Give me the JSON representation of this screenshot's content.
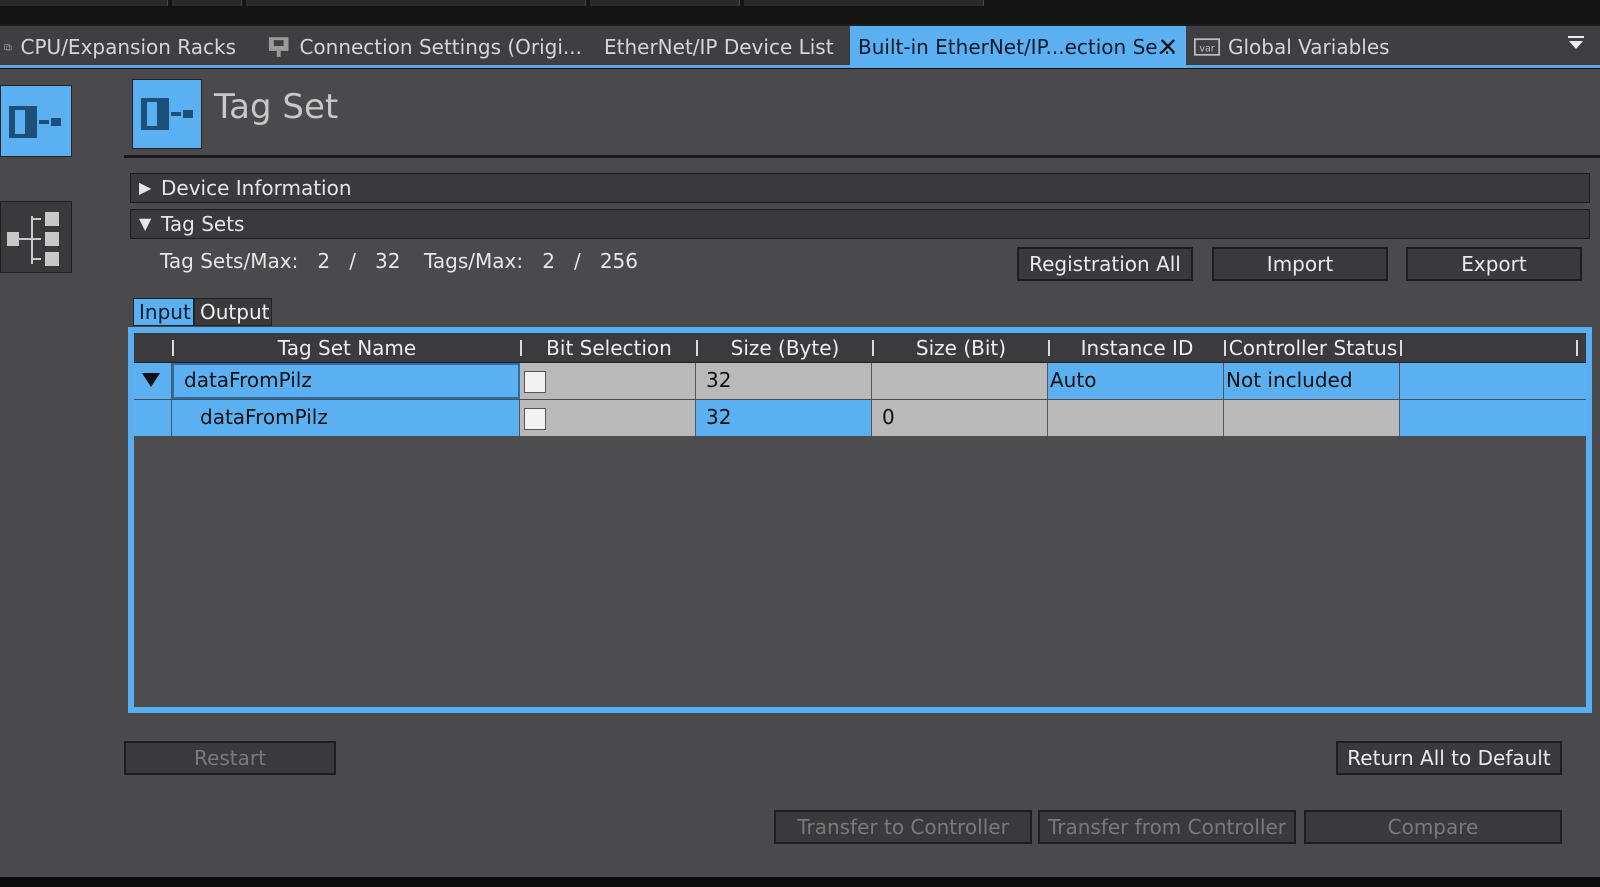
{
  "tabs": [
    {
      "label": "CPU/Expansion Racks",
      "icon": "rack-icon",
      "active": false
    },
    {
      "label": "Connection Settings (Origi...",
      "icon": "connection-icon",
      "active": false
    },
    {
      "label": "EtherNet/IP Device List",
      "icon": "",
      "active": false
    },
    {
      "label": "Built-in EtherNet/IP...ection Se...",
      "icon": "",
      "active": true,
      "close": "✕"
    },
    {
      "label": "Global Variables",
      "icon": "var-icon",
      "active": false
    }
  ],
  "page": {
    "title": "Tag Set"
  },
  "sections": {
    "device_information": {
      "label": "Device Information",
      "expanded": false,
      "toggle": "▶"
    },
    "tag_sets": {
      "label": "Tag Sets",
      "expanded": true,
      "toggle": "▼"
    }
  },
  "stats": {
    "tag_sets_label": "Tag Sets/Max:",
    "tag_sets_value": "2",
    "tag_sets_max": "32",
    "tags_label": "Tags/Max:",
    "tags_value": "2",
    "tags_max": "256",
    "slash": "/"
  },
  "buttons": {
    "registration_all": "Registration All",
    "import": "Import",
    "export": "Export",
    "restart": "Restart",
    "return_all_default": "Return All to Default",
    "transfer_to": "Transfer to Controller",
    "transfer_from": "Transfer from Controller",
    "compare": "Compare"
  },
  "subtabs": {
    "input": "Input",
    "output": "Output",
    "active": "input"
  },
  "table": {
    "columns": [
      "Tag Set Name",
      "Bit Selection",
      "Size (Byte)",
      "Size (Bit)",
      "Instance ID",
      "Controller Status"
    ],
    "rows": [
      {
        "name": "dataFromPilz",
        "bit_selection": false,
        "size_byte": "32",
        "size_bit": "",
        "instance_id": "Auto",
        "controller_status": "Not included",
        "expanded": true
      },
      {
        "name": "dataFromPilz",
        "bit_selection": false,
        "size_byte": "32",
        "size_bit": "0",
        "instance_id": "",
        "controller_status": "",
        "child": true
      }
    ]
  },
  "colors": {
    "accent": "#5ab0f0",
    "background": "#4a4a4d",
    "header": "#3b3b3e"
  }
}
